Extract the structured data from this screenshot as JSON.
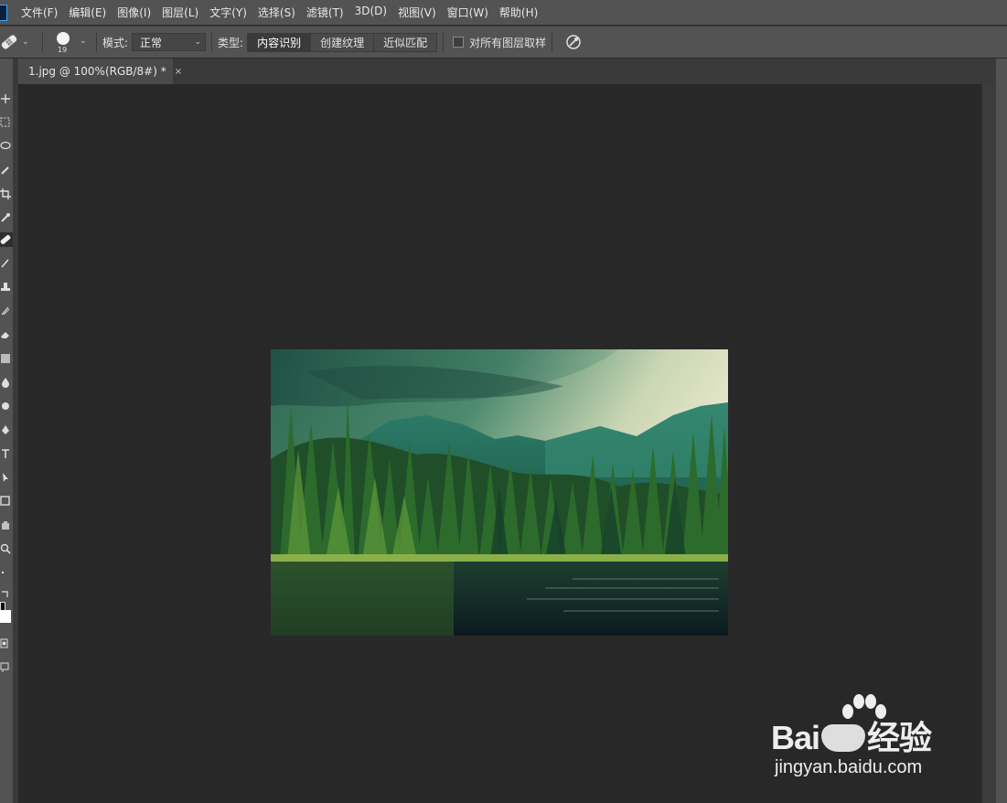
{
  "menu": {
    "items": [
      "文件(F)",
      "编辑(E)",
      "图像(I)",
      "图层(L)",
      "文字(Y)",
      "选择(S)",
      "滤镜(T)",
      "3D(D)",
      "视图(V)",
      "窗口(W)",
      "帮助(H)"
    ]
  },
  "options": {
    "brush_size": "19",
    "mode_label": "模式:",
    "mode_value": "正常",
    "type_label": "类型:",
    "type_options": [
      "内容识别",
      "创建纹理",
      "近似匹配"
    ],
    "type_selected": "内容识别",
    "sample_all_layers_label": "对所有图层取样",
    "sample_all_layers_checked": false
  },
  "document": {
    "tab_title": "1.jpg @ 100%(RGB/8#) *",
    "close_glyph": "×"
  },
  "watermark": {
    "brand": "Baidu经验",
    "brand_prefix": "Bai",
    "brand_suffix": "经验",
    "url": "jingyan.baidu.com"
  },
  "colors": {
    "chrome": "#535353",
    "canvas": "#282828",
    "accent": "#31a8ff"
  },
  "icons": {
    "tool_preset": "spot-healing-brush-icon",
    "pressure": "pressure-size-icon"
  }
}
